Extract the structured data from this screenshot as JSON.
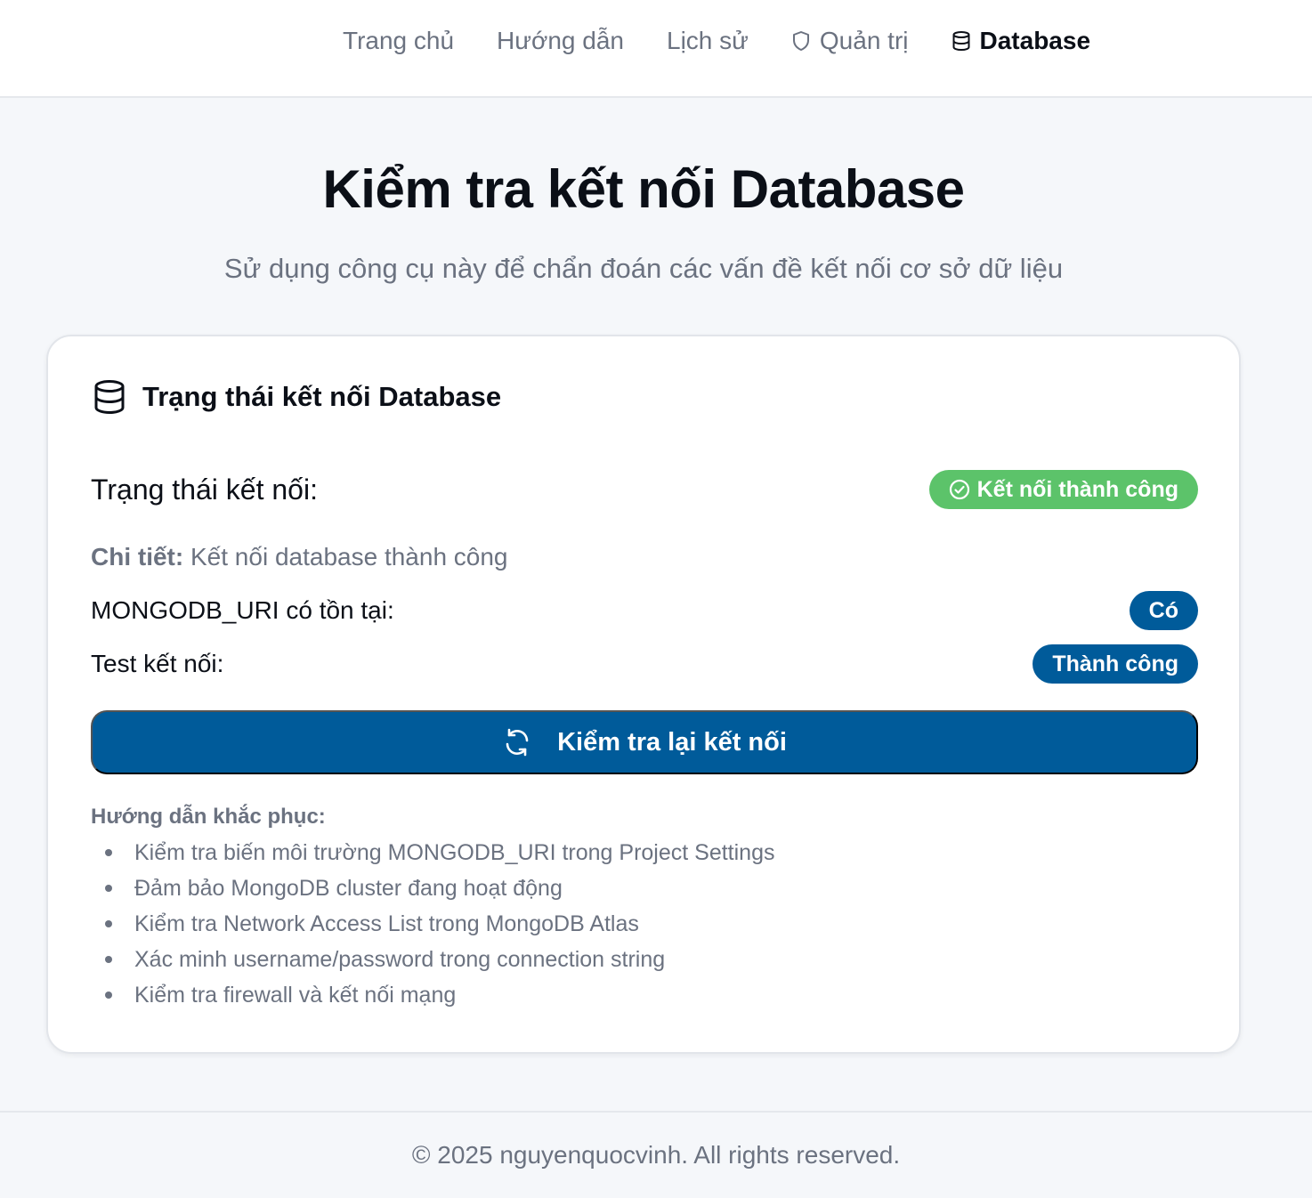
{
  "nav": {
    "items": [
      {
        "label": "Trang chủ",
        "icon": ""
      },
      {
        "label": "Hướng dẫn",
        "icon": ""
      },
      {
        "label": "Lịch sử",
        "icon": ""
      },
      {
        "label": "Quản trị",
        "icon": "shield-icon"
      },
      {
        "label": "Database",
        "icon": "database-icon",
        "active": true
      }
    ]
  },
  "hero": {
    "title": "Kiểm tra kết nối Database",
    "subtitle": "Sử dụng công cụ này để chẩn đoán các vấn đề kết nối cơ sở dữ liệu"
  },
  "card": {
    "title": "Trạng thái kết nối Database",
    "icon": "database-icon",
    "status_label": "Trạng thái kết nối:",
    "status_badge": "Kết nối thành công",
    "status_color": "#5cc36a",
    "detail_label": "Chi tiết:",
    "detail_value": "Kết nối database thành công",
    "uri_label": "MONGODB_URI có tồn tại:",
    "uri_badge": "Có",
    "test_label": "Test kết nối:",
    "test_badge": "Thành công",
    "badge_color": "#005b9a",
    "retest_button": "Kiểm tra lại kết nối",
    "guide_title": "Hướng dẫn khắc phục:",
    "guide_items": [
      "Kiểm tra biến môi trường MONGODB_URI trong Project Settings",
      "Đảm bảo MongoDB cluster đang hoạt động",
      "Kiểm tra Network Access List trong MongoDB Atlas",
      "Xác minh username/password trong connection string",
      "Kiểm tra firewall và kết nối mạng"
    ]
  },
  "footer": {
    "text": "© 2025 nguyenquocvinh. All rights reserved."
  }
}
